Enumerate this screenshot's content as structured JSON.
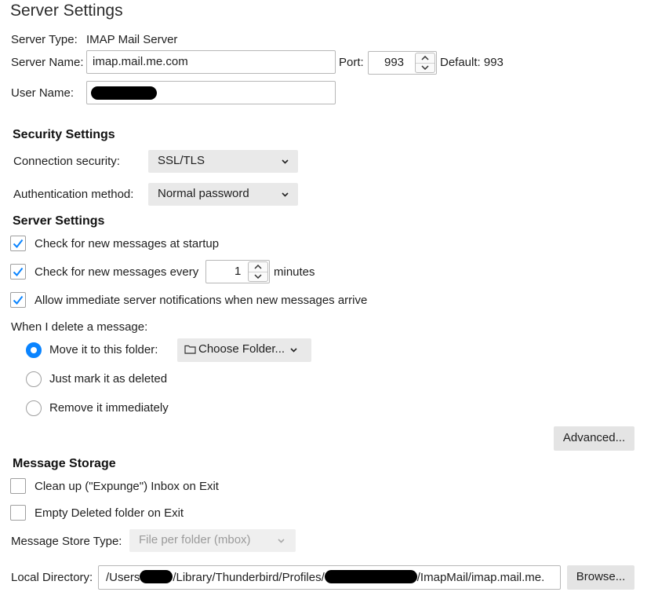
{
  "page_title": "Server Settings",
  "server": {
    "type_label": "Server Type:",
    "type_value": "IMAP Mail Server",
    "name_label": "Server Name:",
    "name_value": "imap.mail.me.com",
    "port_label": "Port:",
    "port_value": "993",
    "default_label": "Default: 993",
    "user_label": "User Name:",
    "user_value": ""
  },
  "security": {
    "heading": "Security Settings",
    "connection_label": "Connection security:",
    "connection_value": "SSL/TLS",
    "auth_label": "Authentication method:",
    "auth_value": "Normal password"
  },
  "server_settings": {
    "heading": "Server Settings",
    "check_startup_label": "Check for new messages at startup",
    "check_startup_checked": true,
    "check_every_label": "Check for new messages every",
    "check_every_checked": true,
    "check_every_value": "1",
    "minutes_label": "minutes",
    "allow_notify_label": "Allow immediate server notifications when new messages arrive",
    "allow_notify_checked": true
  },
  "delete": {
    "label": "When I delete a message:",
    "option_move": "Move it to this folder:",
    "option_mark": "Just mark it as deleted",
    "option_remove": "Remove it immediately",
    "selected": "move",
    "folder_button": "Choose Folder..."
  },
  "advanced_button": "Advanced...",
  "storage": {
    "heading": "Message Storage",
    "cleanup_label": "Clean up (\"Expunge\") Inbox on Exit",
    "cleanup_checked": false,
    "empty_deleted_label": "Empty Deleted folder on Exit",
    "empty_deleted_checked": false,
    "store_type_label": "Message Store Type:",
    "store_type_value": "File per folder (mbox)",
    "local_dir_label": "Local Directory:",
    "local_dir_parts": [
      "/Users",
      "/Library/Thunderbird/Profiles/",
      "/ImapMail/imap.mail.me."
    ],
    "browse_button": "Browse..."
  },
  "icons": {
    "check": "checkmark-icon",
    "chevron": "chevron-down-icon",
    "folder": "folder-icon",
    "spin_up": "spin-up-icon",
    "spin_down": "spin-down-icon"
  },
  "colors": {
    "accent": "#0a84ff",
    "button_bg": "#e4e4e4",
    "redaction": "#000000"
  }
}
